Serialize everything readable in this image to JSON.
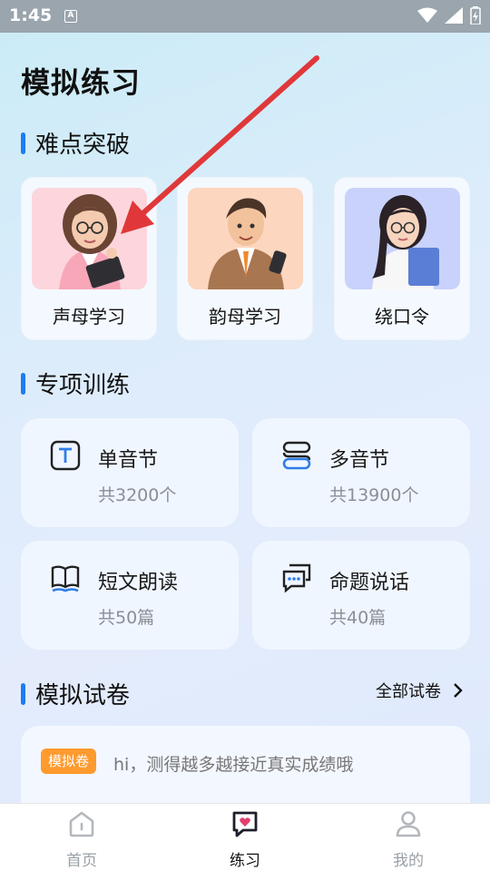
{
  "status_bar": {
    "time": "1:45",
    "notif_glyph": "A"
  },
  "page_title": "模拟练习",
  "sections": {
    "difficulty": "难点突破",
    "special": "专项训练",
    "mock": "模拟试卷"
  },
  "difficulty_cards": [
    {
      "label": "声母学习",
      "illustration": "woman-with-clipboard"
    },
    {
      "label": "韵母学习",
      "illustration": "man-with-phone"
    },
    {
      "label": "绕口令",
      "illustration": "woman-with-book"
    }
  ],
  "training_cards": [
    {
      "title": "单音节",
      "count": "共3200个",
      "icon": "text-icon"
    },
    {
      "title": "多音节",
      "count": "共13900个",
      "icon": "layers-icon"
    },
    {
      "title": "短文朗读",
      "count": "共50篇",
      "icon": "book-icon"
    },
    {
      "title": "命题说话",
      "count": "共40篇",
      "icon": "chat-icon"
    }
  ],
  "mock": {
    "all_link": "全部试卷",
    "badge": "模拟卷",
    "description": "hi，测得越多越接近真实成绩哦"
  },
  "tabs": [
    {
      "label": "首页",
      "icon": "home-icon",
      "active": false
    },
    {
      "label": "练习",
      "icon": "practice-icon",
      "active": true
    },
    {
      "label": "我的",
      "icon": "profile-icon",
      "active": false
    }
  ],
  "colors": {
    "accent": "#1d7cf2",
    "badge": "#ff9a2e",
    "annotation_arrow": "#e0383a"
  }
}
